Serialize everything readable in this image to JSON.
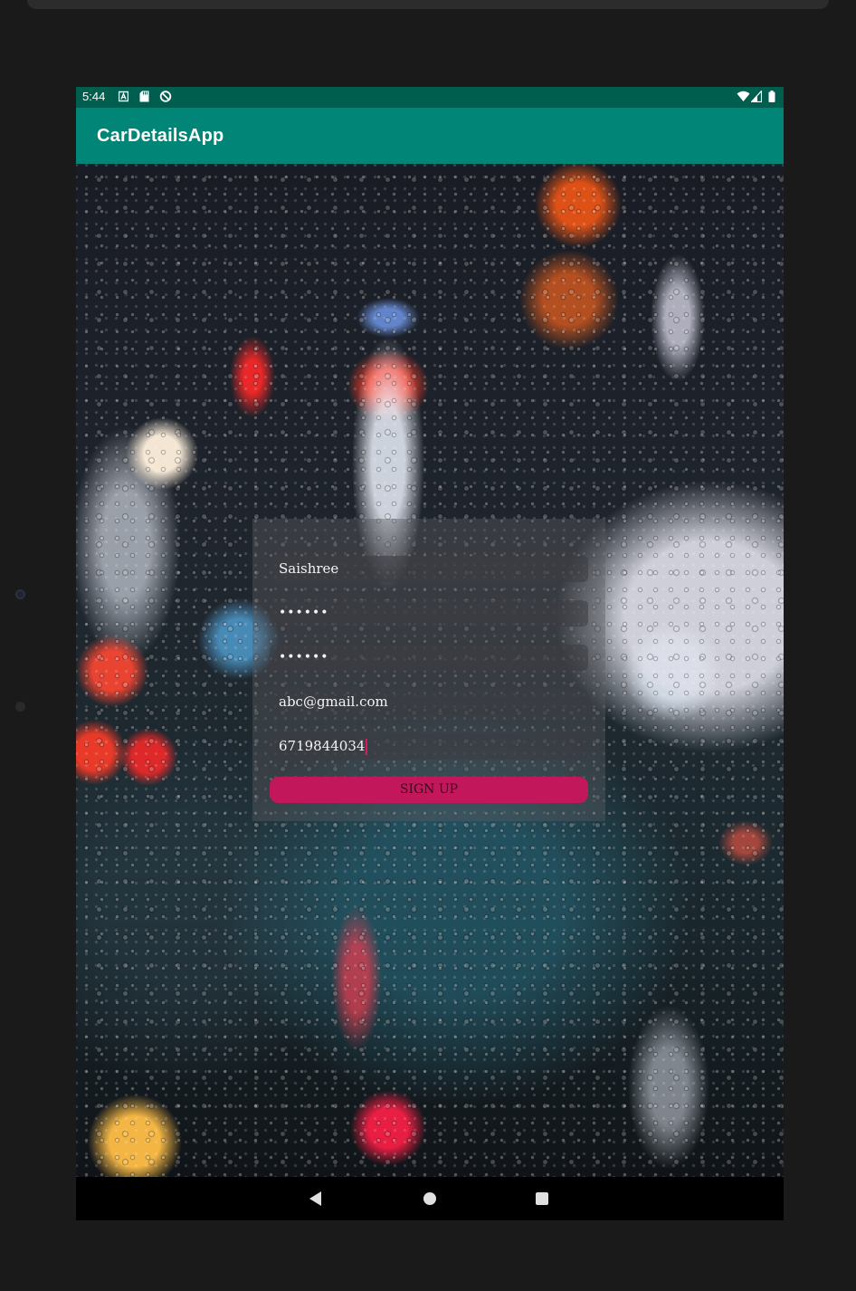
{
  "status_bar": {
    "time": "5:44",
    "left_icons": [
      "a-notification-icon",
      "sd-card-icon",
      "data-saver-icon"
    ],
    "right_icons": [
      "wifi-icon",
      "signal-icon",
      "battery-icon"
    ]
  },
  "app_bar": {
    "title": "CarDetailsApp"
  },
  "signup_form": {
    "username": "Saishree",
    "password": "••••••",
    "confirm_password": "••••••",
    "email": "abc@gmail.com",
    "phone": "6719844034",
    "signup_label": "SIGN UP"
  },
  "colors": {
    "status_bar": "#005e4f",
    "app_bar": "#008577",
    "accent": "#c2185b",
    "caret": "#d81b60"
  },
  "nav_bar": {
    "buttons": [
      "back-icon",
      "home-icon",
      "recents-icon"
    ]
  }
}
